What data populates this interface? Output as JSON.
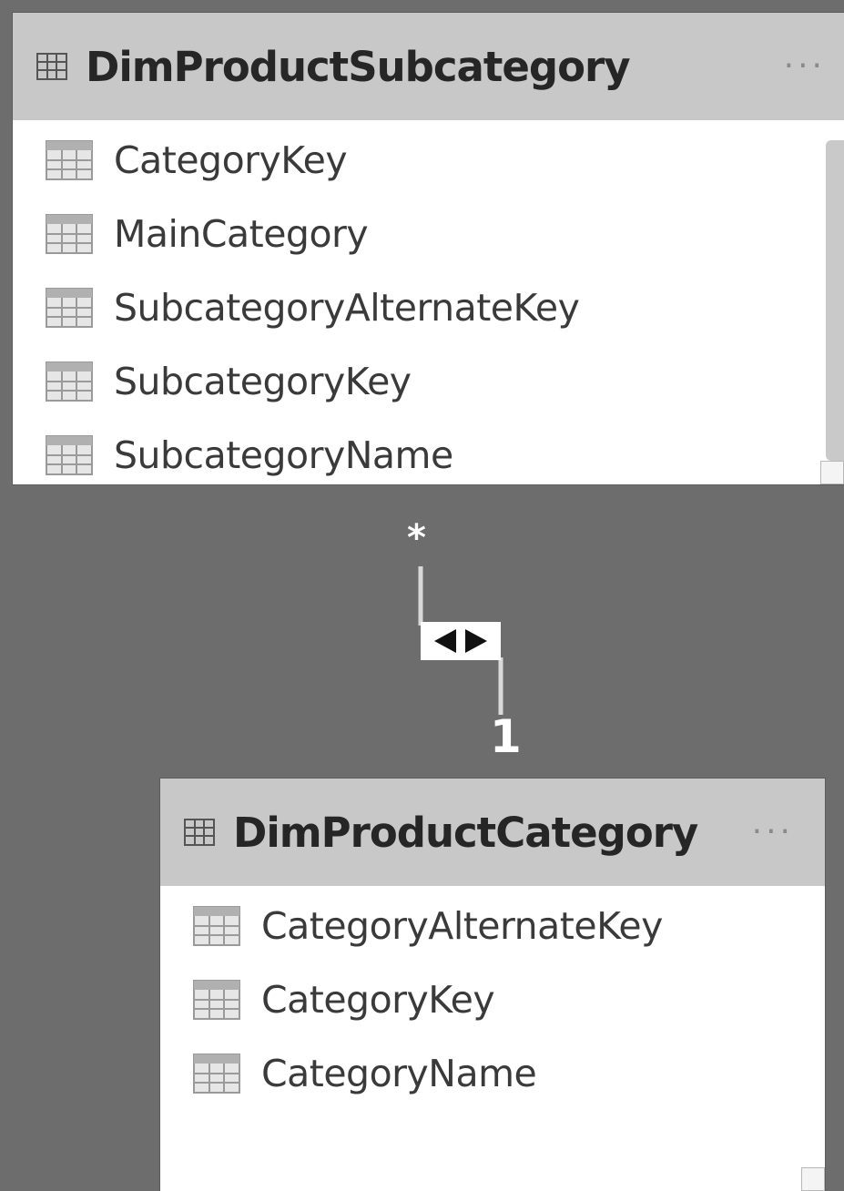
{
  "tables": [
    {
      "title": "DimProductSubcategory",
      "menu": "···",
      "fields": [
        "CategoryKey",
        "MainCategory",
        "SubcategoryAlternateKey",
        "SubcategoryKey",
        "SubcategoryName"
      ]
    },
    {
      "title": "DimProductCategory",
      "menu": "···",
      "fields": [
        "CategoryAlternateKey",
        "CategoryKey",
        "CategoryName"
      ]
    }
  ],
  "relationship": {
    "from_cardinality": "*",
    "to_cardinality": "1",
    "cross_filter": "both",
    "icon": "bidirectional-arrows-icon"
  },
  "colors": {
    "canvas": "#6d6d6d",
    "header": "#c8c8c8",
    "card": "#ffffff",
    "connector": "#d9d9d9"
  }
}
